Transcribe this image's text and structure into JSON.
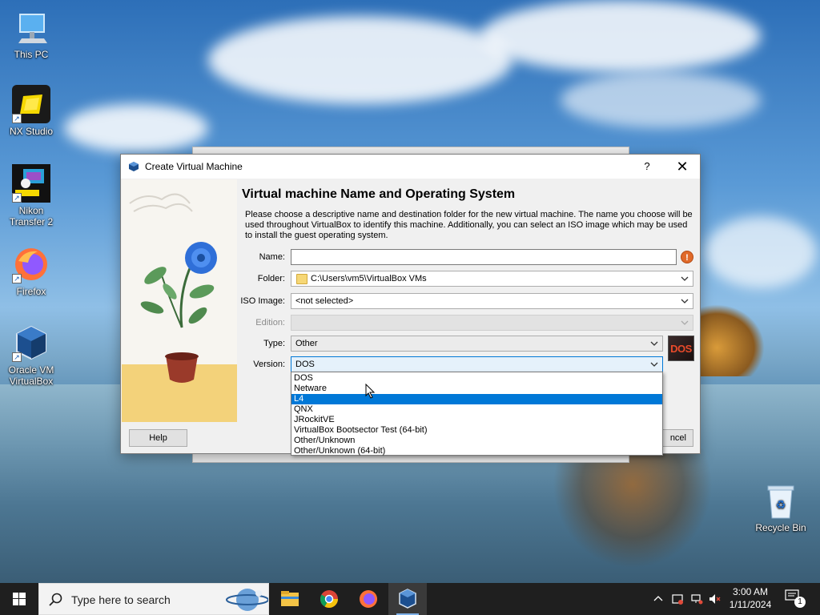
{
  "desktop": {
    "icons": [
      {
        "label": "This PC",
        "icon": "computer-icon"
      },
      {
        "label": "NX Studio",
        "icon": "nx-studio-icon"
      },
      {
        "label": "Nikon Transfer 2",
        "icon": "nikon-transfer-icon"
      },
      {
        "label": "Firefox",
        "icon": "firefox-icon"
      },
      {
        "label": "Oracle VM VirtualBox",
        "icon": "virtualbox-icon"
      },
      {
        "label": "Recycle Bin",
        "icon": "recycle-bin-icon"
      }
    ]
  },
  "dialog": {
    "title": "Create Virtual Machine",
    "help_glyph": "?",
    "close_glyph": "✕",
    "heading": "Virtual machine Name and Operating System",
    "description": "Please choose a descriptive name and destination folder for the new virtual machine. The name you choose will be used throughout VirtualBox to identify this machine. Additionally, you can select an ISO image which may be used to install the guest operating system.",
    "fields": {
      "name_label": "Name:",
      "name_value": "",
      "folder_label": "Folder:",
      "folder_value": "C:\\Users\\vm5\\VirtualBox VMs",
      "iso_label": "ISO Image:",
      "iso_value": "<not selected>",
      "edition_label": "Edition:",
      "edition_value": "",
      "type_label": "Type:",
      "type_value": "Other",
      "version_label": "Version:",
      "version_value": "DOS"
    },
    "os_badge": "DOS",
    "warning_glyph": "!",
    "help_button": "Help",
    "cancel_button_partial": "ncel"
  },
  "version_dropdown": {
    "options": [
      "DOS",
      "Netware",
      "L4",
      "QNX",
      "JRockitVE",
      "VirtualBox Bootsector Test (64-bit)",
      "Other/Unknown",
      "Other/Unknown (64-bit)"
    ],
    "selected_index": 2
  },
  "taskbar": {
    "search_placeholder": "Type here to search",
    "apps": [
      "file-explorer-icon",
      "chrome-icon",
      "firefox-icon",
      "virtualbox-icon"
    ],
    "clock_time": "3:00 AM",
    "clock_date": "1/11/2024",
    "notification_count": "1"
  },
  "colors": {
    "accent": "#0078d7",
    "taskbar": "#1f1f1f",
    "dialog_bg": "#f0f0f0"
  }
}
